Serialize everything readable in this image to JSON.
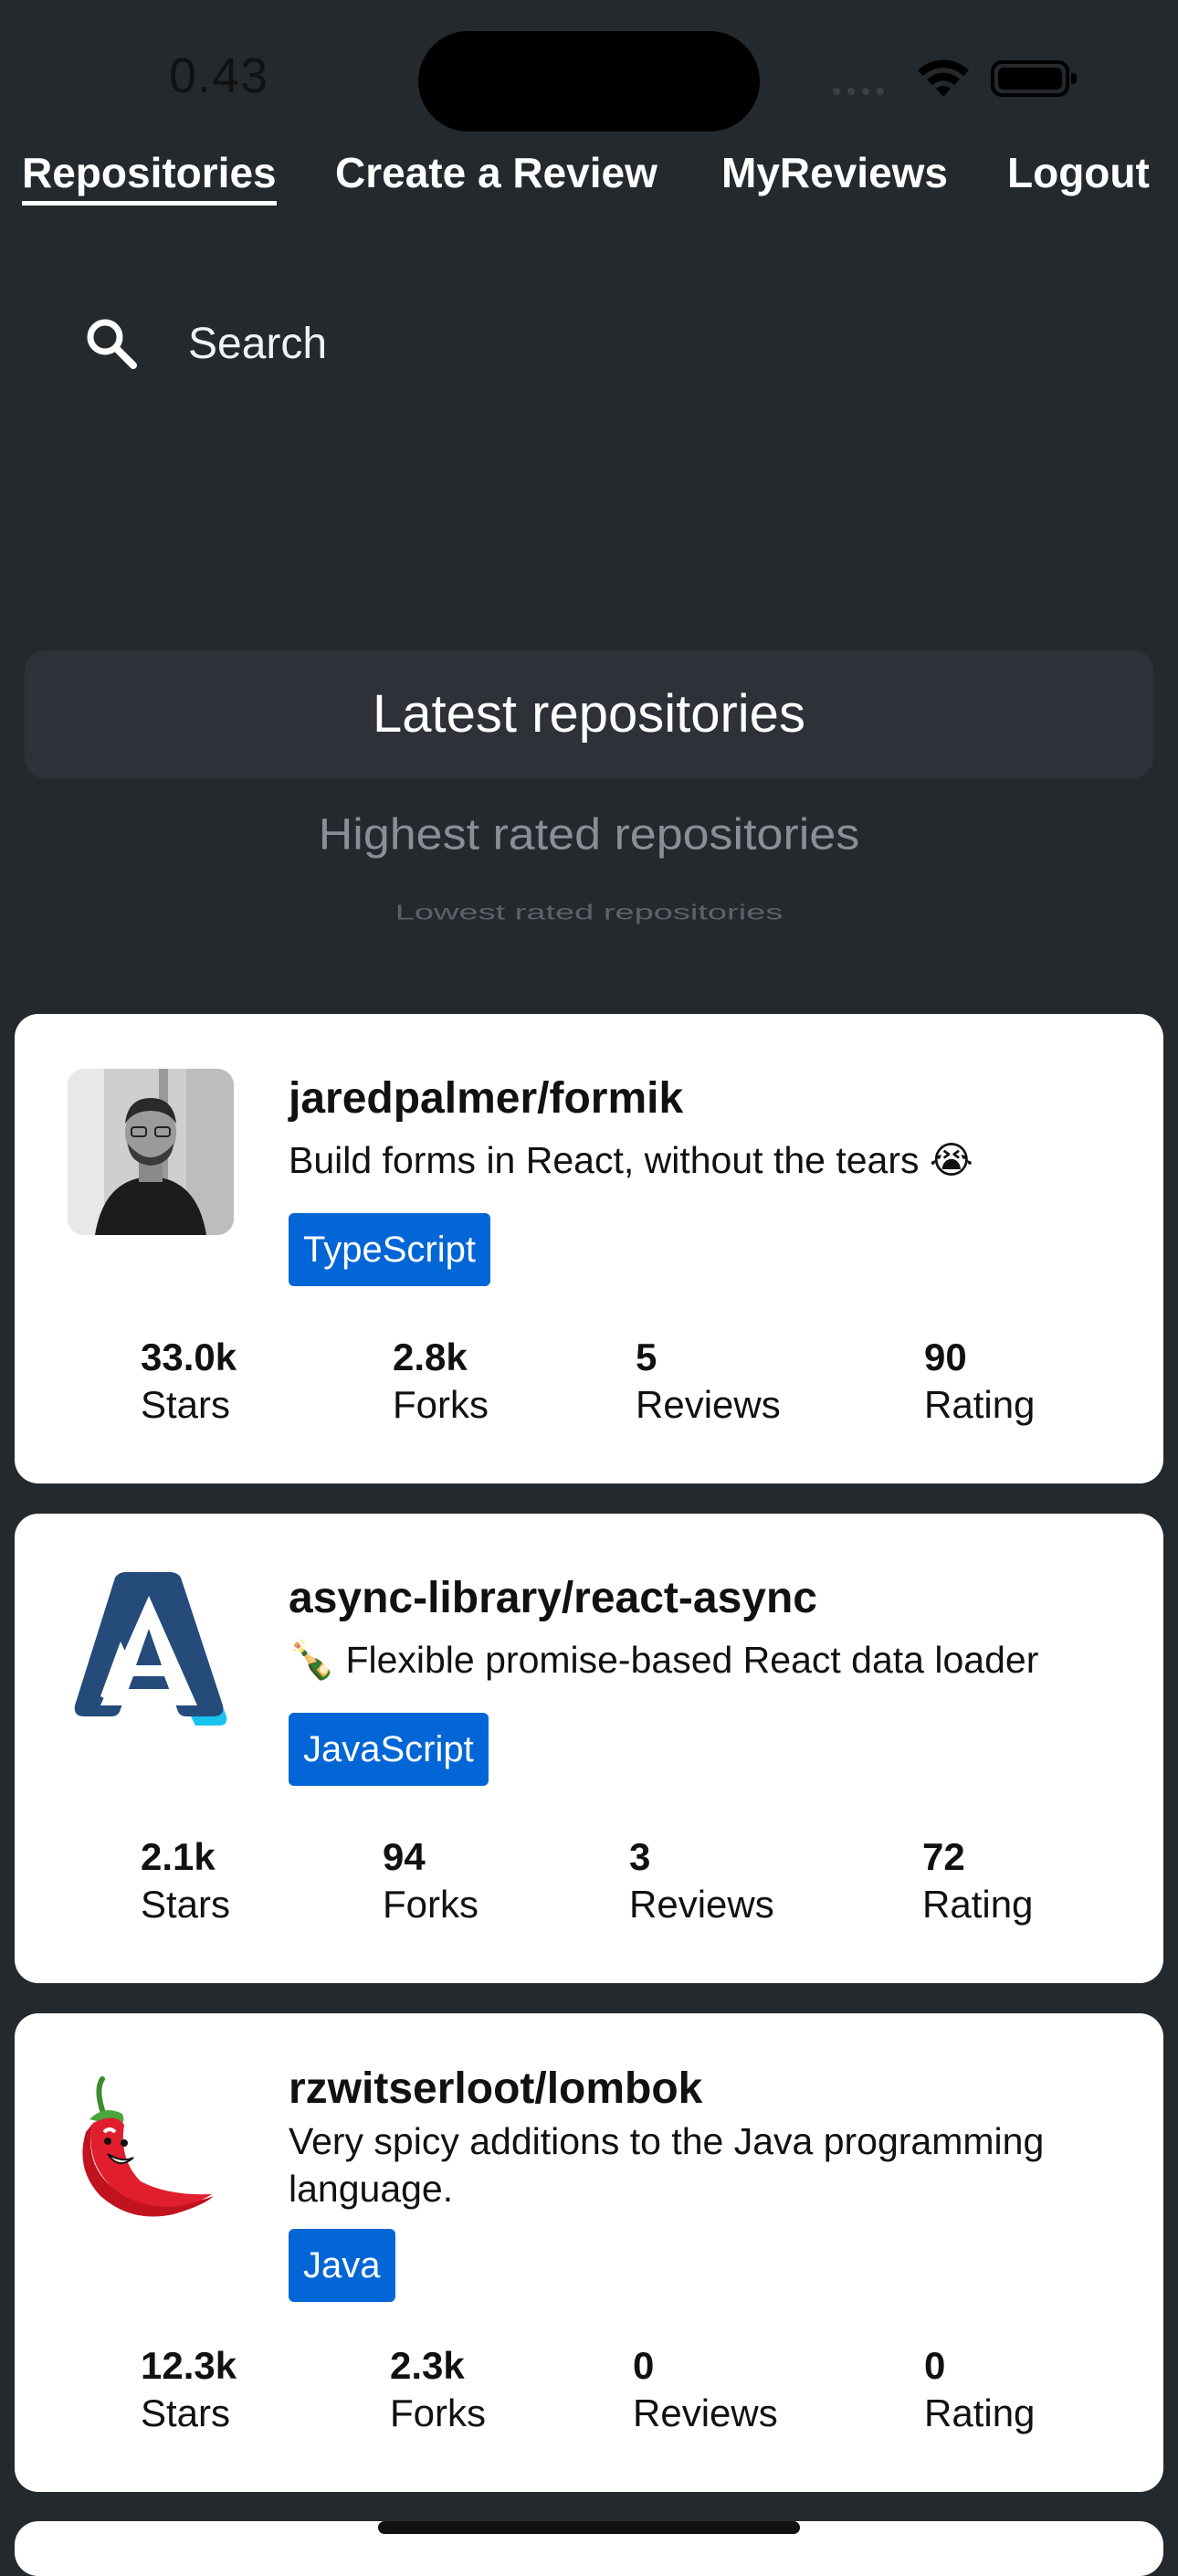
{
  "status": {
    "time": "0.43"
  },
  "tabs": [
    "Repositories",
    "Create a Review",
    "MyReviews",
    "Logout"
  ],
  "search": {
    "placeholder": "Search",
    "value": ""
  },
  "sort_options": [
    "Latest repositories",
    "Highest rated repositories",
    "Lowest rated repositories"
  ],
  "repositories": [
    {
      "full_name": "jaredpalmer/formik",
      "description": "Build forms in React, without the tears 😭",
      "language": "TypeScript",
      "stars": "33.0k",
      "forks": "2.8k",
      "reviews": "5",
      "rating": "90"
    },
    {
      "full_name": "async-library/react-async",
      "description": "🍾 Flexible promise-based React data loader",
      "language": "JavaScript",
      "stars": "2.1k",
      "forks": "94",
      "reviews": "3",
      "rating": "72"
    },
    {
      "full_name": "rzwitserloot/lombok",
      "description": "Very spicy additions to the Java programming language.",
      "language": "Java",
      "stars": "12.3k",
      "forks": "2.3k",
      "reviews": "0",
      "rating": "0"
    }
  ],
  "stat_labels": {
    "stars": "Stars",
    "forks": "Forks",
    "reviews": "Reviews",
    "rating": "Rating"
  },
  "colors": {
    "background": "#24292e",
    "accent": "#0366d6",
    "card": "#ffffff"
  }
}
